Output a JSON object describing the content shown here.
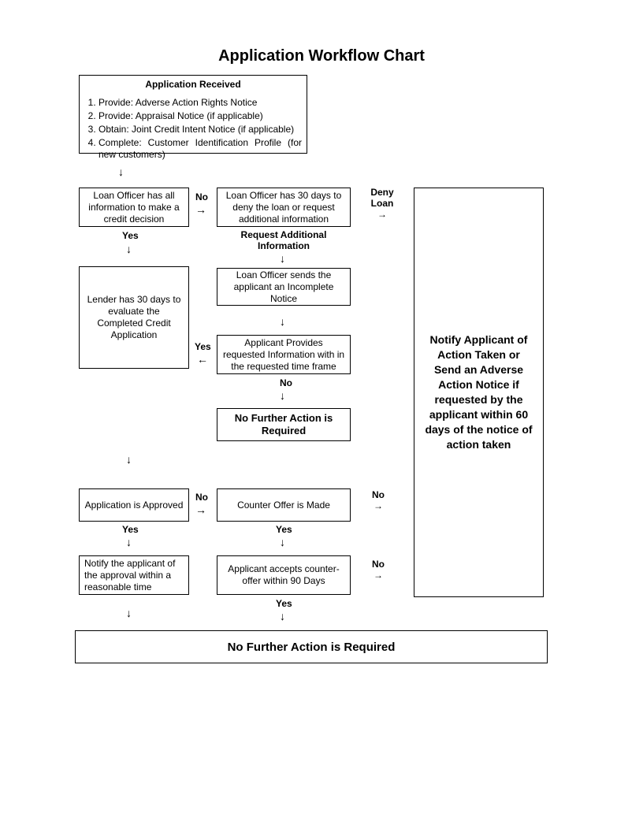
{
  "title": "Application Workflow Chart",
  "app_received": {
    "header": "Application Received",
    "items": [
      "Provide: Adverse Action Rights Notice",
      "Provide: Appraisal Notice (if applicable)",
      "Obtain: Joint Credit Intent Notice (if applicable)",
      "Complete: Customer Identification Profile (for new customers)"
    ]
  },
  "nodes": {
    "has_info": "Loan Officer has all information to make a credit decision",
    "thirty_days_deny": "Loan Officer has 30 days to deny the loan or request additional information",
    "lender_eval": "Lender has 30 days to evaluate the Completed Credit Application",
    "incomplete_notice": "Loan Officer sends the applicant an Incomplete Notice",
    "applicant_provides": "Applicant Provides requested Information with in the requested time frame",
    "no_further_1": "No Further Action is Required",
    "approved": "Application is Approved",
    "counter_made": "Counter Offer is Made",
    "notify_approval": "Notify the applicant of the approval within a reasonable time",
    "accepts_counter": "Applicant accepts counter-offer within 90 Days",
    "no_further_2": "No Further Action is Required"
  },
  "labels": {
    "yes": "Yes",
    "no": "No",
    "deny_loan": "Deny Loan",
    "request_additional": "Request Additional Information"
  },
  "right_box": "Notify Applicant of Action Taken or\nSend an Adverse Action Notice if requested by the applicant within 60 days of the notice of action taken",
  "arrows": {
    "down": "↓",
    "right": "→",
    "left": "←"
  }
}
